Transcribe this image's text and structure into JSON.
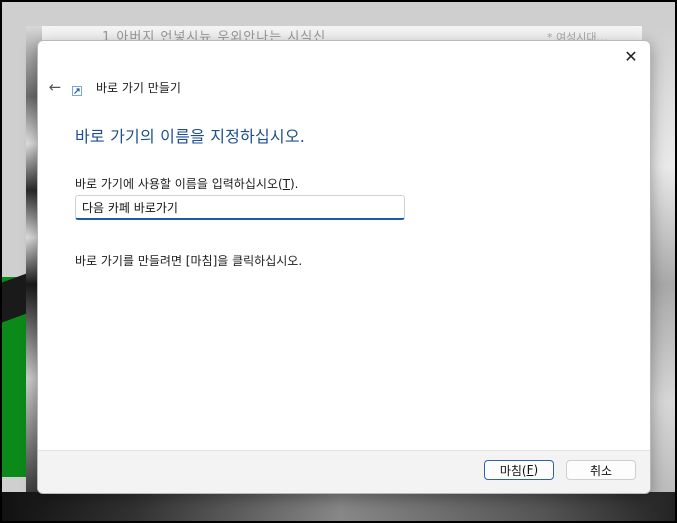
{
  "background": {
    "top_text": "1   아버지 언넣시뉴 우외안나는 시식신",
    "top_right_text": "* 여성시대..."
  },
  "dialog": {
    "close_glyph": "✕",
    "back_glyph": "←",
    "wizard_title": "바로 가기 만들기",
    "heading": "바로 가기의 이름을 지정하십시오.",
    "prompt_label": "바로 가기에 사용할 이름을 입력하십시오(",
    "prompt_key": "T",
    "prompt_label_end": ").",
    "name_value": "다음 카페 바로가기",
    "finish_hint": "바로 가기를 만들려면 [마침]을 클릭하십시오."
  },
  "footer": {
    "finish_label": "마침(",
    "finish_key": "F",
    "finish_end": ")",
    "cancel_label": "취소"
  },
  "colors": {
    "heading": "#1e4f8d",
    "input_focus": "#1e5aa8",
    "primary_border": "#2c62b0"
  }
}
